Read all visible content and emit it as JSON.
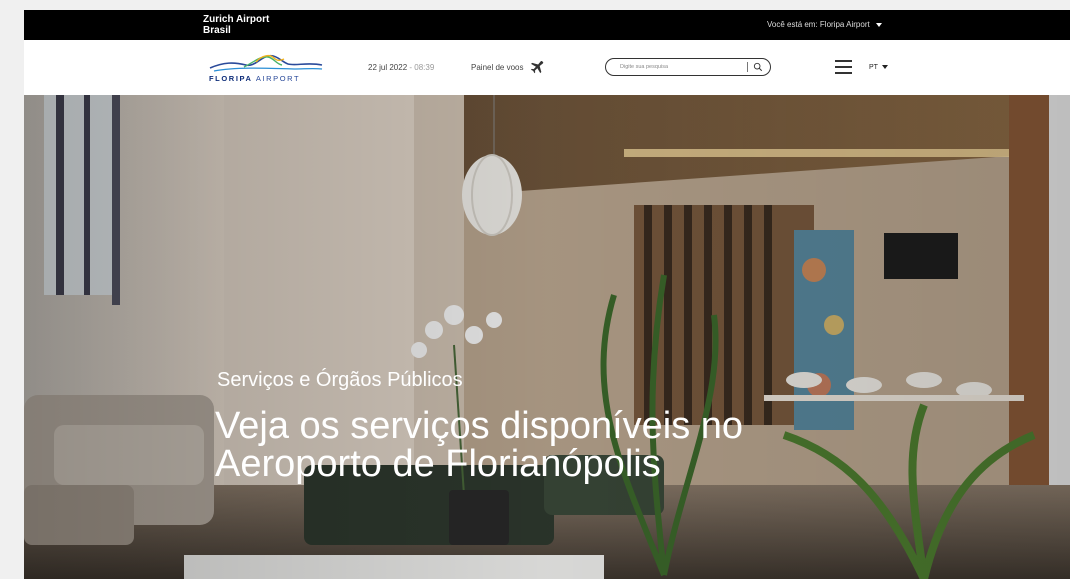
{
  "topbar": {
    "brand_line1": "Zurich Airport",
    "brand_line2": "Brasil",
    "location": "Você está em: Floripa Airport"
  },
  "header": {
    "logo_bold": "FLORIPA",
    "logo_light": " AIRPORT",
    "date": "22 jul 2022",
    "time_sep": " - ",
    "time": "08:39",
    "flights_label": "Painel de voos",
    "search_placeholder": "Digite sua pesquisa",
    "language": "PT"
  },
  "hero": {
    "subtitle": "Serviços e Órgãos Públicos",
    "title": "Veja os serviços disponíveis no Aeroporto de Florianópolis"
  },
  "colors": {
    "topbar_bg": "#000000",
    "logo_blue": "#2a4a9a",
    "logo_wave_green": "#4ab36a",
    "logo_wave_yellow": "#f2b21c"
  },
  "icons": {
    "plane": "plane-icon",
    "search": "search-icon",
    "menu": "hamburger-menu-icon"
  }
}
